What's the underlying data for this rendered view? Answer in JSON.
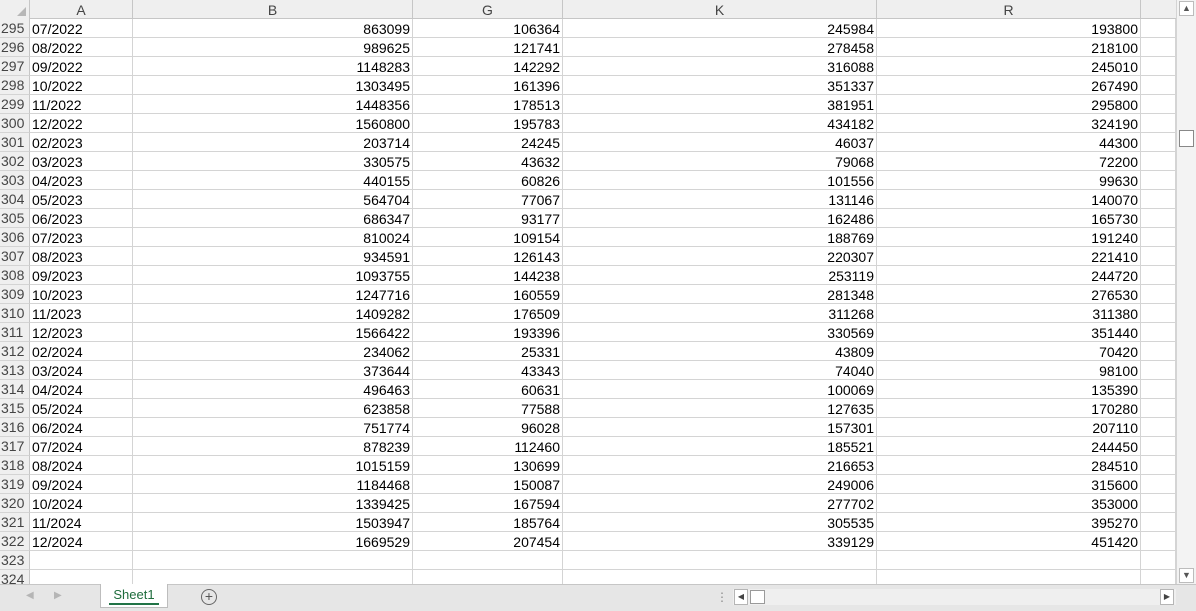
{
  "columns": [
    "A",
    "B",
    "G",
    "K",
    "R"
  ],
  "rows": [
    {
      "num": "295",
      "cells": [
        "07/2022",
        "863099",
        "106364",
        "245984",
        "193800"
      ]
    },
    {
      "num": "296",
      "cells": [
        "08/2022",
        "989625",
        "121741",
        "278458",
        "218100"
      ]
    },
    {
      "num": "297",
      "cells": [
        "09/2022",
        "1148283",
        "142292",
        "316088",
        "245010"
      ]
    },
    {
      "num": "298",
      "cells": [
        "10/2022",
        "1303495",
        "161396",
        "351337",
        "267490"
      ]
    },
    {
      "num": "299",
      "cells": [
        "11/2022",
        "1448356",
        "178513",
        "381951",
        "295800"
      ]
    },
    {
      "num": "300",
      "cells": [
        "12/2022",
        "1560800",
        "195783",
        "434182",
        "324190"
      ]
    },
    {
      "num": "301",
      "cells": [
        "02/2023",
        "203714",
        "24245",
        "46037",
        "44300"
      ]
    },
    {
      "num": "302",
      "cells": [
        "03/2023",
        "330575",
        "43632",
        "79068",
        "72200"
      ]
    },
    {
      "num": "303",
      "cells": [
        "04/2023",
        "440155",
        "60826",
        "101556",
        "99630"
      ]
    },
    {
      "num": "304",
      "cells": [
        "05/2023",
        "564704",
        "77067",
        "131146",
        "140070"
      ]
    },
    {
      "num": "305",
      "cells": [
        "06/2023",
        "686347",
        "93177",
        "162486",
        "165730"
      ]
    },
    {
      "num": "306",
      "cells": [
        "07/2023",
        "810024",
        "109154",
        "188769",
        "191240"
      ]
    },
    {
      "num": "307",
      "cells": [
        "08/2023",
        "934591",
        "126143",
        "220307",
        "221410"
      ]
    },
    {
      "num": "308",
      "cells": [
        "09/2023",
        "1093755",
        "144238",
        "253119",
        "244720"
      ]
    },
    {
      "num": "309",
      "cells": [
        "10/2023",
        "1247716",
        "160559",
        "281348",
        "276530"
      ]
    },
    {
      "num": "310",
      "cells": [
        "11/2023",
        "1409282",
        "176509",
        "311268",
        "311380"
      ]
    },
    {
      "num": "311",
      "cells": [
        "12/2023",
        "1566422",
        "193396",
        "330569",
        "351440"
      ]
    },
    {
      "num": "312",
      "cells": [
        "02/2024",
        "234062",
        "25331",
        "43809",
        "70420"
      ]
    },
    {
      "num": "313",
      "cells": [
        "03/2024",
        "373644",
        "43343",
        "74040",
        "98100"
      ]
    },
    {
      "num": "314",
      "cells": [
        "04/2024",
        "496463",
        "60631",
        "100069",
        "135390"
      ]
    },
    {
      "num": "315",
      "cells": [
        "05/2024",
        "623858",
        "77588",
        "127635",
        "170280"
      ]
    },
    {
      "num": "316",
      "cells": [
        "06/2024",
        "751774",
        "96028",
        "157301",
        "207110"
      ]
    },
    {
      "num": "317",
      "cells": [
        "07/2024",
        "878239",
        "112460",
        "185521",
        "244450"
      ]
    },
    {
      "num": "318",
      "cells": [
        "08/2024",
        "1015159",
        "130699",
        "216653",
        "284510"
      ]
    },
    {
      "num": "319",
      "cells": [
        "09/2024",
        "1184468",
        "150087",
        "249006",
        "315600"
      ]
    },
    {
      "num": "320",
      "cells": [
        "10/2024",
        "1339425",
        "167594",
        "277702",
        "353000"
      ]
    },
    {
      "num": "321",
      "cells": [
        "11/2024",
        "1503947",
        "185764",
        "305535",
        "395270"
      ]
    },
    {
      "num": "322",
      "cells": [
        "12/2024",
        "1669529",
        "207454",
        "339129",
        "451420"
      ]
    },
    {
      "num": "323",
      "cells": [
        "",
        "",
        "",
        "",
        ""
      ]
    },
    {
      "num": "324",
      "cells": [
        "",
        "",
        "",
        "",
        ""
      ]
    }
  ],
  "sheet_tab": {
    "label": "Sheet1"
  },
  "icons": {
    "add_sheet": "plus-circle-icon",
    "scroll_up": "triangle-up-icon",
    "scroll_down": "triangle-down-icon",
    "scroll_left": "triangle-left-icon",
    "scroll_right": "triangle-right-icon"
  },
  "colors": {
    "accent": "#217346",
    "tab_text": "#1e6c3c"
  }
}
